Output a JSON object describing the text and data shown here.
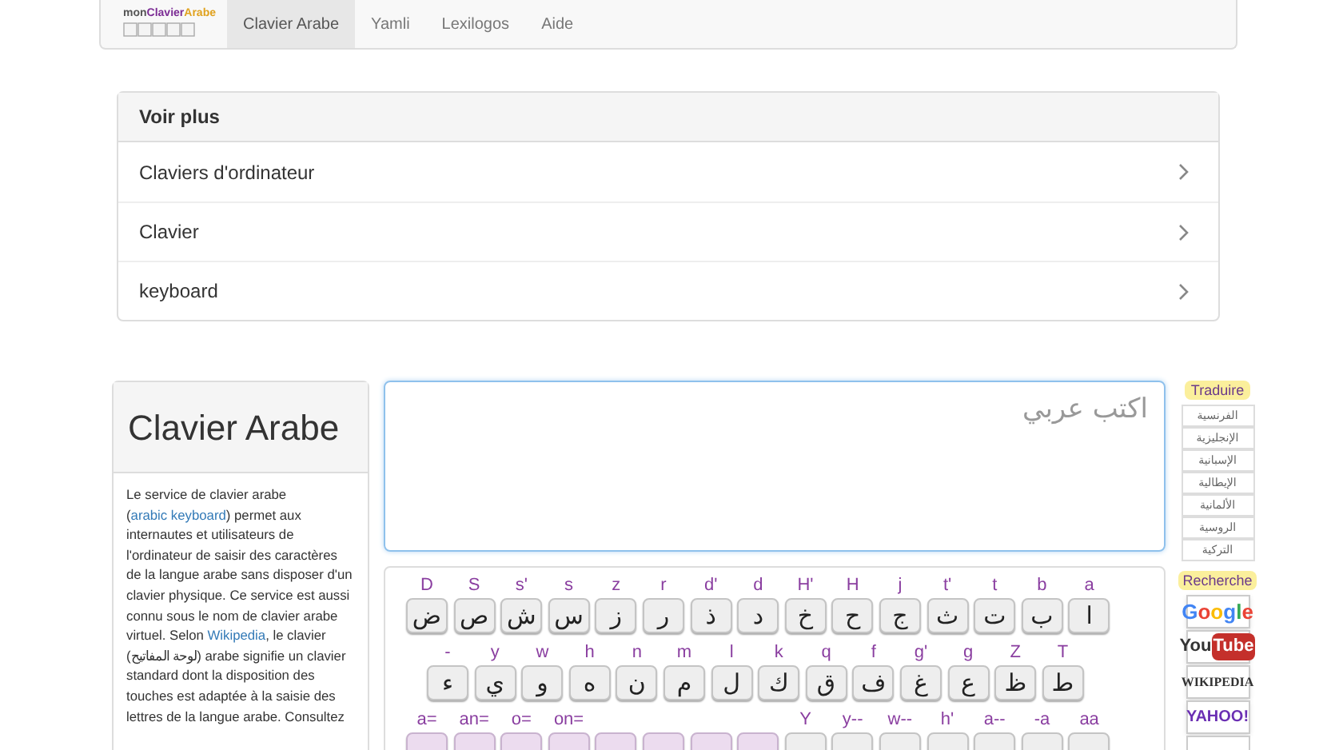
{
  "navbar": {
    "logo": {
      "prefix": "mon",
      "middle": "Clavier",
      "suffix": "Arabe"
    },
    "tabs": [
      {
        "label": "Clavier Arabe",
        "selected": true
      },
      {
        "label": "Yamli",
        "selected": false
      },
      {
        "label": "Lexilogos",
        "selected": false
      },
      {
        "label": "Aide",
        "selected": false
      }
    ]
  },
  "voir_plus": {
    "title": "Voir plus",
    "items": [
      "Claviers d'ordinateur",
      "Clavier",
      "keyboard"
    ]
  },
  "info_panel": {
    "title": "Clavier Arabe",
    "paragraph": [
      {
        "kind": "text",
        "text": "Le service de clavier arabe ("
      },
      {
        "kind": "link",
        "text": "arabic keyboard"
      },
      {
        "kind": "text",
        "text": ") permet aux internautes et utilisateurs de l'ordinateur de saisir des caractères de la langue arabe sans disposer d'un clavier physique. Ce service est aussi connu sous le nom de clavier arabe virtuel. Selon "
      },
      {
        "kind": "link",
        "text": "Wikipedia"
      },
      {
        "kind": "text",
        "text": ", le clavier (لوحة المفاتيح) arabe signifie un clavier standard dont la disposition des touches est adaptée à la saisie des lettres de la langue arabe. Consultez"
      }
    ]
  },
  "editor": {
    "placeholder": "اكتب عربي"
  },
  "keyboard": {
    "rows": [
      [
        {
          "hint": "D",
          "char": "ض"
        },
        {
          "hint": "S",
          "char": "ص"
        },
        {
          "hint": "s'",
          "char": "ش"
        },
        {
          "hint": "s",
          "char": "س"
        },
        {
          "hint": "z",
          "char": "ز"
        },
        {
          "hint": "r",
          "char": "ر"
        },
        {
          "hint": "d'",
          "char": "ذ"
        },
        {
          "hint": "d",
          "char": "د"
        },
        {
          "hint": "H'",
          "char": "خ"
        },
        {
          "hint": "H",
          "char": "ح"
        },
        {
          "hint": "j",
          "char": "ج"
        },
        {
          "hint": "t'",
          "char": "ث"
        },
        {
          "hint": "t",
          "char": "ت"
        },
        {
          "hint": "b",
          "char": "ب"
        },
        {
          "hint": "a",
          "char": "ا"
        }
      ],
      [
        {
          "hint": "-",
          "char": "ء"
        },
        {
          "hint": "y",
          "char": "ي"
        },
        {
          "hint": "w",
          "char": "و"
        },
        {
          "hint": "h",
          "char": "ه"
        },
        {
          "hint": "n",
          "char": "ن"
        },
        {
          "hint": "m",
          "char": "م"
        },
        {
          "hint": "l",
          "char": "ل"
        },
        {
          "hint": "k",
          "char": "ك"
        },
        {
          "hint": "q",
          "char": "ق"
        },
        {
          "hint": "f",
          "char": "ف"
        },
        {
          "hint": "g'",
          "char": "غ"
        },
        {
          "hint": "g",
          "char": "ع"
        },
        {
          "hint": "Z",
          "char": "ظ"
        },
        {
          "hint": "T",
          "char": "ط"
        }
      ],
      [
        {
          "hint": "a=",
          "kind": "diacritic"
        },
        {
          "hint": "an=",
          "kind": "diacritic"
        },
        {
          "hint": "o=",
          "kind": "diacritic"
        },
        {
          "hint": "on=",
          "kind": "diacritic"
        },
        {
          "kind": "diacritic"
        },
        {
          "kind": "diacritic"
        },
        {
          "kind": "diacritic"
        },
        {
          "kind": "diacritic"
        },
        {
          "hint": "Y",
          "kind": "letter"
        },
        {
          "hint": "y--",
          "kind": "letter"
        },
        {
          "hint": "w--",
          "kind": "letter"
        },
        {
          "hint": "h'",
          "kind": "letter"
        },
        {
          "hint": "a--",
          "kind": "letter"
        },
        {
          "hint": "-a",
          "kind": "letter"
        },
        {
          "hint": "aa",
          "kind": "letter"
        }
      ]
    ]
  },
  "translate": {
    "title": "Traduire",
    "items": [
      "الفرنسية",
      "الإنجليزية",
      "الإسبانية",
      "الإيطالية",
      "الألمانية",
      "الروسية",
      "التركية"
    ]
  },
  "search": {
    "title": "Recherche",
    "items": [
      {
        "kind": "google",
        "label": "Google"
      },
      {
        "kind": "youtube",
        "label": "You",
        "label2": "Tube"
      },
      {
        "kind": "wikipedia",
        "label": "WIKIPEDIA"
      },
      {
        "kind": "yahoo",
        "label": "YAHOO!"
      },
      {
        "kind": "partial"
      }
    ]
  }
}
